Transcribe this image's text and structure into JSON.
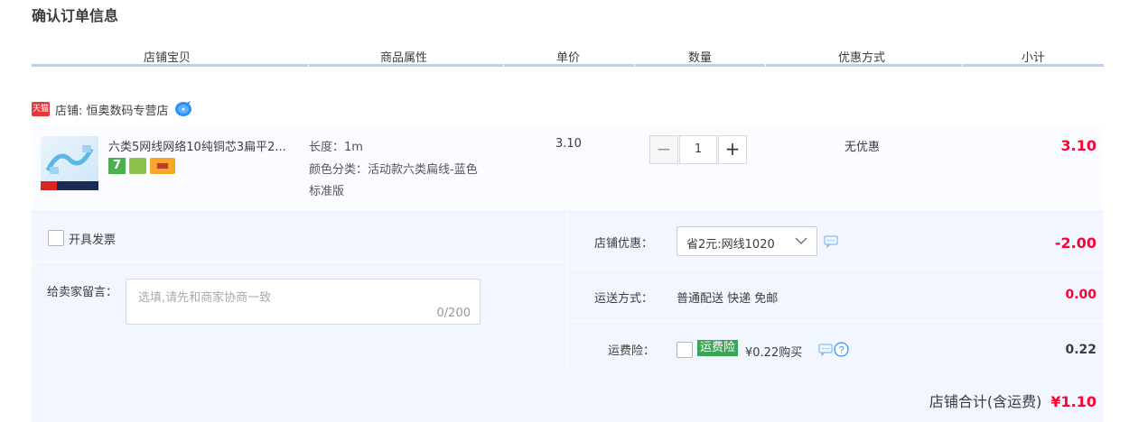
{
  "page_title": "确认订单信息",
  "columns": [
    "店铺宝贝",
    "商品属性",
    "单价",
    "数量",
    "优惠方式",
    "小计"
  ],
  "shop": {
    "badge": "天猫",
    "label": "店铺: 恒奥数码专营店",
    "chat_icon": "wangwang-chat-icon"
  },
  "item": {
    "title": "六类5网线网络10纯铜芯3扁平2...",
    "attr_length": "长度：1m",
    "attr_color": "颜色分类：活动款六类扁线-蓝色",
    "attr_version": "标准版",
    "price": "3.10",
    "quantity": "1",
    "minus": "−",
    "plus": "+",
    "discount": "无优惠",
    "subtotal": "3.10",
    "badge_seven": "7"
  },
  "invoice": {
    "label": "开具发票",
    "checked": false
  },
  "message": {
    "label": "给卖家留言：",
    "placeholder": "选填,请先和商家协商一致",
    "counter": "0/200"
  },
  "store_discount": {
    "label": "店铺优惠：",
    "selected": "省2元:网线1020",
    "value": "-2.00"
  },
  "shipping": {
    "label": "运送方式：",
    "text": "普通配送 快递 免邮",
    "value": "0.00"
  },
  "insurance": {
    "label": "运费险：",
    "tag": "运费险",
    "text": "¥0.22购买",
    "value": "0.22"
  },
  "total": {
    "label": "店铺合计(含运费)",
    "value": "¥1.10"
  },
  "colors": {
    "accent_red": "#ff0036",
    "header_line": "#b2d1ff",
    "panel_bg": "#f2f7ff",
    "insurance_green": "#3aa655"
  }
}
